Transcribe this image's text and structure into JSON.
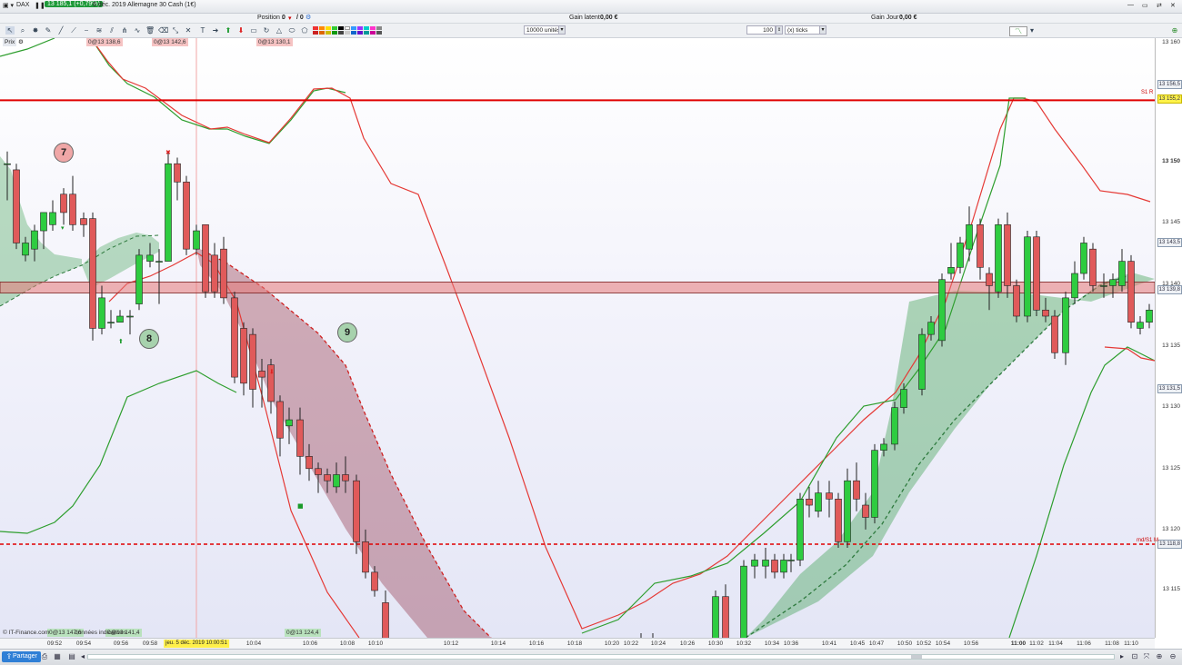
{
  "titlebar": {
    "symbol": "DAX",
    "price_badge": "13 185,1 (+0,79%)",
    "session": "6 déc. 2019 Allemagne 30 Cash (1€)",
    "position_label": "Position :",
    "position_value": "0",
    "position_fraction": "/ 0",
    "gain_latent_label": "Gain latent :",
    "gain_latent_value": "0,00 €",
    "gain_jour_label": "Gain Jour :",
    "gain_jour_value": "0,00 €"
  },
  "toolbar": {
    "units_value": "10000 unités",
    "ticks_count": "100",
    "ticks_unit": "(x) ticks"
  },
  "subbar": {
    "prix_label": "Prix",
    "tags": [
      {
        "text": "0@13 138,6",
        "kind": "red"
      },
      {
        "text": "0@13 142,6",
        "kind": "red"
      },
      {
        "text": "0@13 130,1",
        "kind": "red"
      }
    ]
  },
  "footer_tags": [
    {
      "text": "0@13 147,6",
      "kind": "green"
    },
    {
      "text": "0@13 141,4",
      "kind": "green"
    },
    {
      "text": "0@13 124,4",
      "kind": "green"
    }
  ],
  "annotations": [
    "7",
    "8",
    "9"
  ],
  "copyright": "© IT-Finance.com",
  "copyright_suffix": "données indicatives",
  "yaxis": {
    "labels": [
      "13 160",
      "13 150",
      "13 145",
      "13 140",
      "13 135",
      "13 130",
      "13 125",
      "13 120",
      "13 115"
    ],
    "badges": [
      "13 156,5",
      "13 155,2",
      "13 143,5",
      "13 139,8",
      "13 131,5",
      "13 118,8"
    ],
    "level_r1": "S1 R",
    "level_s": "md/S1 M"
  },
  "xaxis": {
    "labels": [
      "09:52",
      "09:54",
      "09:56",
      "09:58",
      "10:04",
      "10:06",
      "10:08",
      "10:10",
      "10:12",
      "10:14",
      "10:16",
      "10:18",
      "10:20",
      "10:22",
      "10:24",
      "10:26",
      "10:30",
      "10:32",
      "10:34",
      "10:36",
      "10:41",
      "10:45",
      "10:47",
      "10:50",
      "10:52",
      "10:54",
      "10:56",
      "11:00",
      "11:02",
      "11:04",
      "11:06",
      "11:08",
      "11:10"
    ],
    "cursor": "jeu. 5 déc. 2019 10:00:51"
  },
  "bottom": {
    "share_label": "Partager"
  },
  "colors": {
    "up": "#2ecc40",
    "down": "#e05a5a",
    "upper_band": "#e53935",
    "lower_band": "#2e9e2e",
    "level_line": "#e00000"
  }
}
